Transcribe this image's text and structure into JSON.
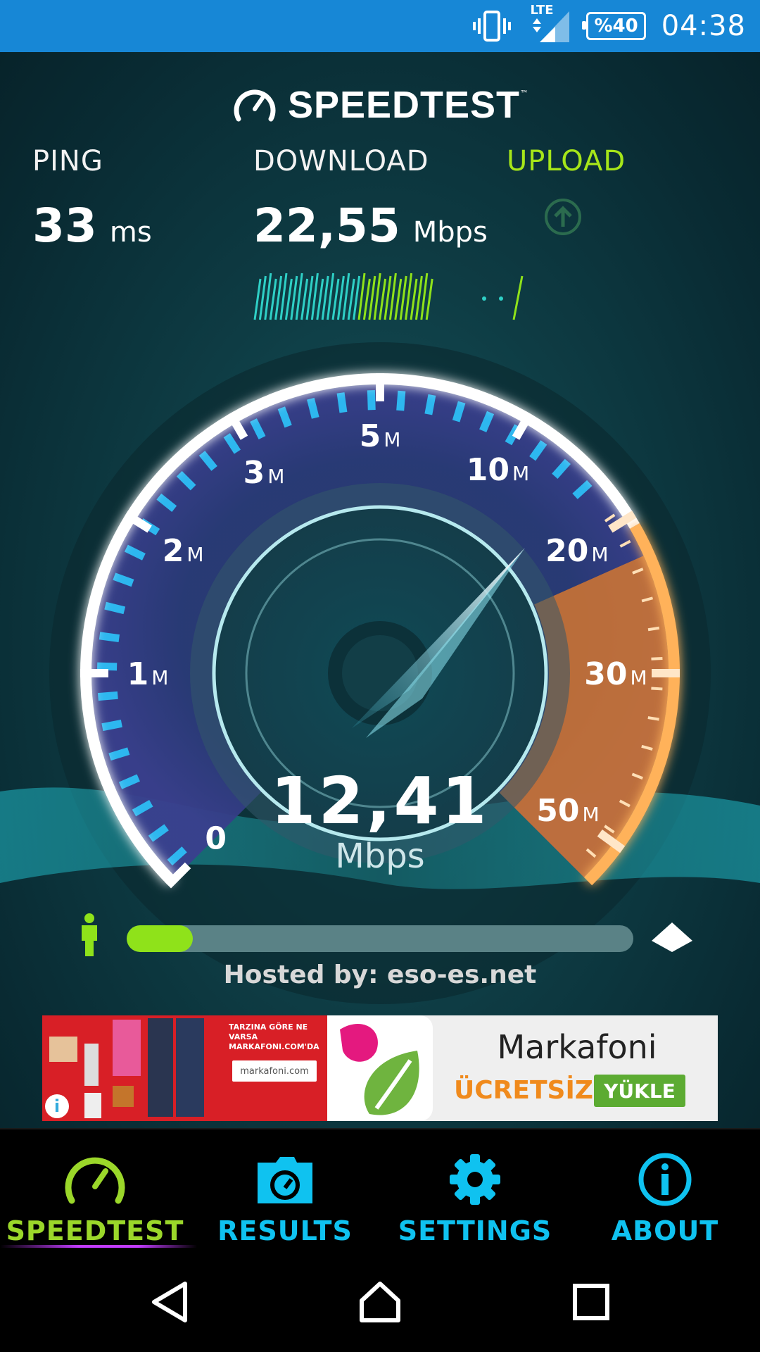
{
  "status_bar": {
    "network": "LTE",
    "battery": "%40",
    "time": "04:38",
    "icons": [
      "vibrate-icon",
      "signal-icon",
      "battery-icon"
    ]
  },
  "header": {
    "brand": "SPEEDTEST",
    "trademark": "™"
  },
  "metrics": {
    "ping": {
      "label": "PING",
      "value": "33",
      "unit": "ms"
    },
    "download": {
      "label": "DOWNLOAD",
      "value": "22,55",
      "unit": "Mbps"
    },
    "upload": {
      "label": "UPLOAD",
      "icon": "arrow-up-circle-icon"
    }
  },
  "gauge": {
    "tick_labels": [
      {
        "num": "0",
        "suf": ""
      },
      {
        "num": "1",
        "suf": "M"
      },
      {
        "num": "2",
        "suf": "M"
      },
      {
        "num": "3",
        "suf": "M"
      },
      {
        "num": "5",
        "suf": "M"
      },
      {
        "num": "10",
        "suf": "M"
      },
      {
        "num": "20",
        "suf": "M"
      },
      {
        "num": "30",
        "suf": "M"
      },
      {
        "num": "50",
        "suf": "M"
      }
    ],
    "current_speed": "12,41",
    "unit": "Mbps"
  },
  "progress": {
    "fraction": 0.13,
    "hosted_by": "Hosted by: eso-es.net"
  },
  "ad": {
    "tagline": "TARZINA GÖRE NE VARSA MARKAFONI.COM'DA",
    "logo_text": "markafoni.com",
    "app_name": "Markafoni",
    "free_label": "ÜCRETSİZ",
    "install_label": "YÜKLE",
    "info_icon": "i"
  },
  "tabs": [
    {
      "label": "SPEEDTEST",
      "icon": "speedometer-icon",
      "active": true
    },
    {
      "label": "RESULTS",
      "icon": "folder-gauge-icon",
      "active": false
    },
    {
      "label": "SETTINGS",
      "icon": "gear-icon",
      "active": false
    },
    {
      "label": "ABOUT",
      "icon": "info-icon",
      "active": false
    }
  ],
  "nav": [
    "back-icon",
    "home-icon",
    "recents-icon"
  ],
  "colors": {
    "status_bar": "#1787d6",
    "accent_green": "#9bd72a",
    "accent_cyan": "#0fc2f0",
    "gauge_orange": "#e8822c",
    "progress_fill": "#8fe21a"
  }
}
